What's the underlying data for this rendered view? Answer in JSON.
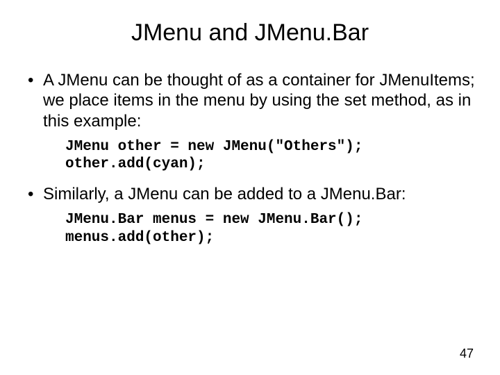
{
  "title": "JMenu and JMenu.Bar",
  "bullets": [
    {
      "text": "A JMenu can be thought of as a container for JMenuItems; we place items in the menu by using the set method, as in this example:",
      "code": "JMenu other = new JMenu(\"Others\");\nother.add(cyan);"
    },
    {
      "text": "Similarly, a JMenu can be added to a JMenu.Bar:",
      "code": "JMenu.Bar menus = new JMenu.Bar();\nmenus.add(other);"
    }
  ],
  "page_number": "47"
}
